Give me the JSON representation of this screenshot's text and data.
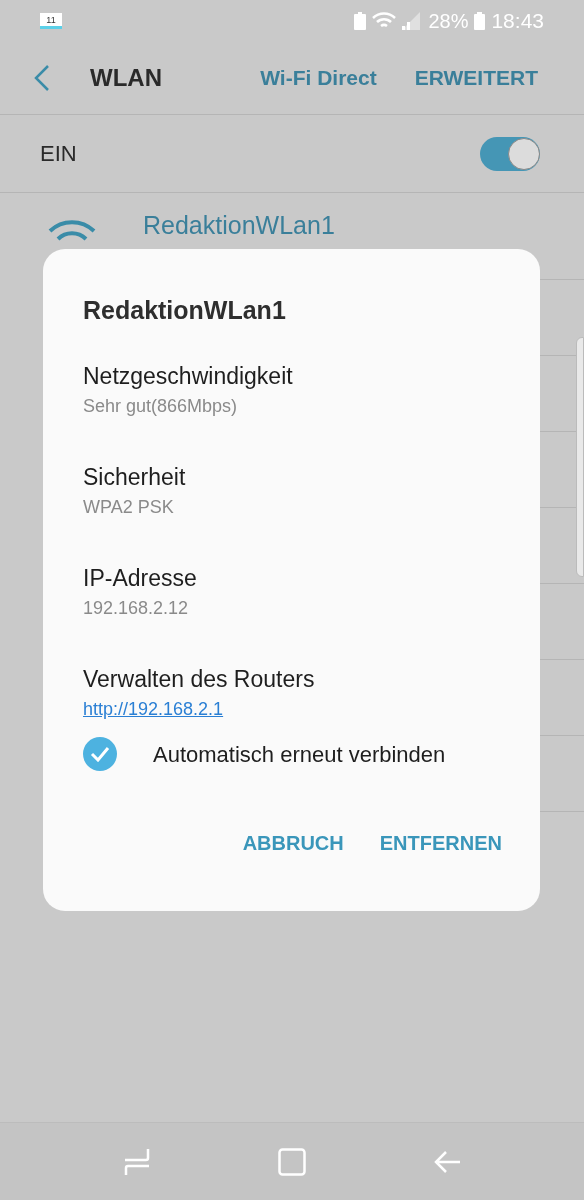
{
  "status_bar": {
    "notification_badge": "11",
    "battery": "28%",
    "time": "18:43"
  },
  "header": {
    "title": "WLAN",
    "actions": [
      "Wi-Fi Direct",
      "ERWEITERT"
    ]
  },
  "master_switch": {
    "label": "EIN",
    "on": true
  },
  "networks": [
    {
      "name": "RedaktionWLan1"
    }
  ],
  "dialog": {
    "title": "RedaktionWLan1",
    "fields": [
      {
        "label": "Netzgeschwindigkeit",
        "value": "Sehr gut(866Mbps)",
        "kind": "text"
      },
      {
        "label": "Sicherheit",
        "value": "WPA2 PSK",
        "kind": "text"
      },
      {
        "label": "IP-Adresse",
        "value": "192.168.2.12",
        "kind": "text"
      },
      {
        "label": "Verwalten des Routers",
        "value": "http://192.168.2.1",
        "kind": "link"
      }
    ],
    "auto_reconnect": {
      "label": "Automatisch erneut verbinden",
      "checked": true
    },
    "buttons": [
      "ABBRUCH",
      "ENTFERNEN"
    ]
  }
}
